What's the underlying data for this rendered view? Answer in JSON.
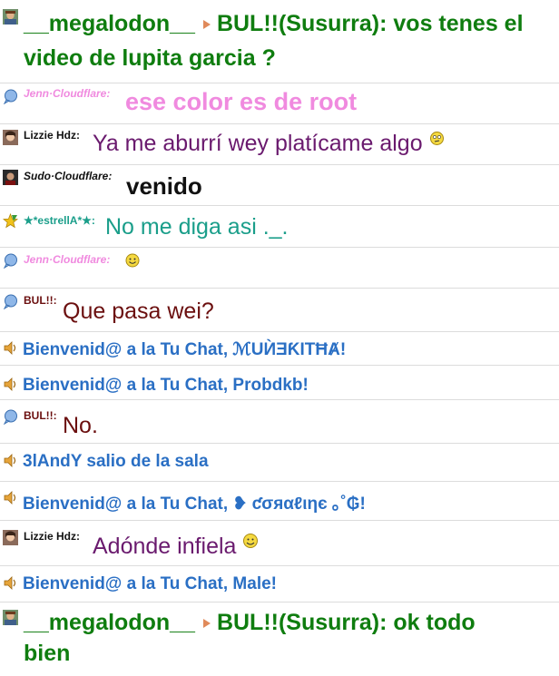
{
  "colors": {
    "system": "#2a6fc4",
    "megalodon": "#0f7d0f",
    "jenn": "#f08adf",
    "lizzie": "#6a1a6e",
    "sudo": "#111111",
    "estrella": "#1a9e8a",
    "bul": "#6b0f0f"
  },
  "messages": [
    {
      "type": "pm",
      "avatar": "avatar-icon",
      "from": "__megalodon__",
      "to": "BUL!!",
      "tag": "(Susurra):",
      "text_line1": "vos tenes el",
      "text_line2": "video de lupita garcia ?"
    },
    {
      "type": "chat",
      "avatar": "bubble-icon",
      "nick": "Jenn·Cloudflare:",
      "text": "ese color es de root"
    },
    {
      "type": "chat",
      "avatar": "avatar-icon",
      "nick": "Lizzie Hdz:",
      "text": "Ya me aburrí wey platícame algo",
      "emoji": "confused-smiley-icon"
    },
    {
      "type": "chat",
      "avatar": "avatar-icon",
      "nick": "Sudo·Cloudflare:",
      "text": "venido"
    },
    {
      "type": "chat",
      "avatar": "star-icon",
      "nick": "★*estrellA*★:",
      "text": "No me diga asi ._."
    },
    {
      "type": "chat",
      "avatar": "bubble-icon",
      "nick": "Jenn·Cloudflare:",
      "text": "",
      "emoji": "smiley-icon"
    },
    {
      "type": "chat",
      "avatar": "bubble-icon",
      "nick": "BUL!!:",
      "text": "Que pasa wei?"
    },
    {
      "type": "system",
      "text": "Bienvenid@ a la Tu Chat, ℳUЍƎƘITĦȺ!"
    },
    {
      "type": "system",
      "text": "Bienvenid@ a la Tu Chat, Probdkb!"
    },
    {
      "type": "chat",
      "avatar": "bubble-icon",
      "nick": "BUL!!:",
      "text": "No."
    },
    {
      "type": "system",
      "text": "3lAndY salio de la sala"
    },
    {
      "type": "system",
      "text": "Bienvenid@ a la Tu Chat, ❥ ƈσяαℓιηє ｡˚₲!"
    },
    {
      "type": "chat",
      "avatar": "avatar-icon",
      "nick": "Lizzie Hdz:",
      "text": "Adónde infiela",
      "emoji": "yellow-face-icon"
    },
    {
      "type": "system",
      "text": "Bienvenid@ a la Tu Chat, Male!"
    },
    {
      "type": "pm",
      "avatar": "avatar-icon",
      "from": "__megalodon__",
      "to": "BUL!!",
      "tag": "(Susurra):",
      "text_line1": "ok todo",
      "text_line2": "bien"
    }
  ]
}
